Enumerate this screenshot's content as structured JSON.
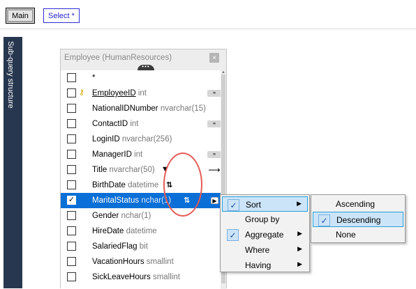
{
  "toolbar": {
    "main_label": "Main",
    "select_label": "Select *"
  },
  "sidebar": {
    "label": "Sub-query structure"
  },
  "table": {
    "title": "Employee (HumanResources)",
    "close_glyph": "×",
    "grip_glyph": "•••",
    "rows": [
      {
        "name": "*",
        "type": "",
        "checked": false
      },
      {
        "name": "EmployeeID",
        "type": "int",
        "checked": false,
        "primary_key": true,
        "relation": "link"
      },
      {
        "name": "NationalIDNumber",
        "type": "nvarchar(15)",
        "checked": false
      },
      {
        "name": "ContactID",
        "type": "int",
        "checked": false,
        "relation": "link"
      },
      {
        "name": "LoginID",
        "type": "nvarchar(256)",
        "checked": false
      },
      {
        "name": "ManagerID",
        "type": "int",
        "checked": false,
        "relation": "link"
      },
      {
        "name": "Title",
        "type": "nvarchar(50)",
        "checked": false,
        "relation": "arrow",
        "indicator": "filter-icon"
      },
      {
        "name": "BirthDate",
        "type": "datetime",
        "checked": false,
        "indicator": "sort-ascending-icon"
      },
      {
        "name": "MaritalStatus",
        "type": "nchar(1)",
        "checked": true,
        "selected": true,
        "indicator": "sort-descending-icon",
        "relation": "submenu-arrow"
      },
      {
        "name": "Gender",
        "type": "nchar(1)",
        "checked": false
      },
      {
        "name": "HireDate",
        "type": "datetime",
        "checked": false
      },
      {
        "name": "SalariedFlag",
        "type": "bit",
        "checked": false
      },
      {
        "name": "VacationHours",
        "type": "smallint",
        "checked": false
      },
      {
        "name": "SickLeaveHours",
        "type": "smallint",
        "checked": false
      }
    ]
  },
  "context_menu": {
    "items": [
      {
        "label": "Sort",
        "checked": true,
        "submenu": true,
        "highlighted": true
      },
      {
        "label": "Group by",
        "checked": false,
        "submenu": false
      },
      {
        "label": "Aggregate",
        "checked": true,
        "submenu": true
      },
      {
        "label": "Where",
        "checked": false,
        "submenu": true
      },
      {
        "label": "Having",
        "checked": false,
        "submenu": true
      }
    ]
  },
  "sort_submenu": {
    "items": [
      {
        "label": "Ascending",
        "checked": false
      },
      {
        "label": "Descending",
        "checked": true,
        "highlighted": true
      },
      {
        "label": "None",
        "checked": false
      }
    ]
  },
  "glyphs": {
    "check": "✓",
    "submenu": "▶",
    "filter": "▼",
    "link": "⚭",
    "arrow": "⟶",
    "play": "▶",
    "key": "🔑"
  },
  "colors": {
    "selection": "#0a6fd6",
    "annotation": "#e55a54",
    "sidebar": "#27374f",
    "menu_highlight": "#cce4f7"
  }
}
